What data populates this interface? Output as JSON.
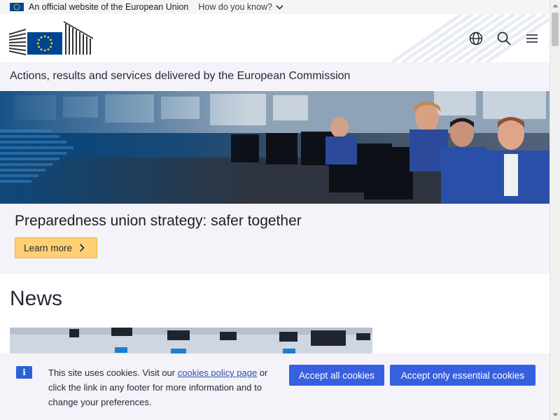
{
  "official_bar": {
    "text": "An official website of the European Union",
    "how_link": "How do you know?"
  },
  "header": {
    "logo": "european-commission-logo",
    "icons": [
      "globe-icon",
      "search-icon",
      "menu-icon"
    ]
  },
  "site_name": "Actions, results and services delivered by the European Commission",
  "hero": {
    "title": "Preparedness union strategy: safer together",
    "button_label": "Learn more"
  },
  "news": {
    "heading": "News"
  },
  "cookie_banner": {
    "info_icon": "i",
    "text_before": "This site uses cookies. Visit our ",
    "link_text": "cookies policy page",
    "text_after": " or click the link in any footer for more information and to change your preferences.",
    "accept_all": "Accept all cookies",
    "accept_essential": "Accept only essential cookies"
  },
  "colors": {
    "eu_blue": "#004494",
    "eu_yellow": "#ffd617",
    "button_blue": "#3760e0",
    "cta_yellow": "#ffd073",
    "panel_bg": "#f3f3f9"
  }
}
